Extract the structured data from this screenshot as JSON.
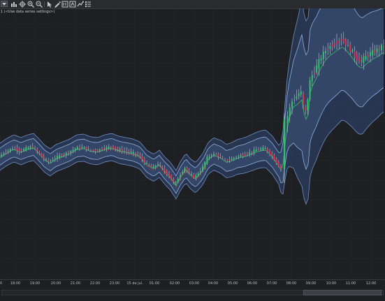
{
  "toolbar": {
    "icons": [
      "dropdown-icon",
      "bar-chart-icon",
      "crosshair-icon",
      "zoom-in-icon",
      "zoom-out-icon",
      "pointer-icon",
      "draw-tools-icon",
      "chart-trader-icon",
      "properties-icon",
      "strategy-icon",
      "list-icon"
    ]
  },
  "series_label": "1 (<Use data series settings>)",
  "axis": {
    "ticks": [
      "0",
      "18:00",
      "19:00",
      "20:00",
      "21:00",
      "22:00",
      "23:00",
      "15 de jul.",
      "01:00",
      "02:00",
      "03:00",
      "04:00",
      "05:00",
      "06:00",
      "07:00",
      "08:00",
      "09:00",
      "10:00",
      "11:00",
      "12:00"
    ]
  },
  "scrollbar": {
    "thumb_start": 0.79,
    "thumb_end": 0.995
  },
  "colors": {
    "background": "#1e1f22",
    "grid": "#2b2c30",
    "band_outer_fill": "#2a3a58",
    "band_inner_fill": "#34486a",
    "band_outer_line": "#6f8fc0",
    "band_mid_line": "#8fb0dc",
    "mid_line": "#3fa66a",
    "candle_up": "#32c26a",
    "candle_down": "#d8334f",
    "wick": "#d9dde6",
    "ma_red": "#c0392b"
  },
  "chart_data": {
    "type": "candlestick",
    "series_name": "1 (<Use data series settings>)",
    "x_ticks": [
      "0",
      "18:00",
      "19:00",
      "20:00",
      "21:00",
      "22:00",
      "23:00",
      "15 de jul.",
      "01:00",
      "02:00",
      "03:00",
      "04:00",
      "05:00",
      "06:00",
      "07:00",
      "08:00",
      "09:00",
      "10:00",
      "11:00",
      "12:00"
    ],
    "grid": true,
    "indicators": [
      "upper/lower envelope bands",
      "inner bands",
      "middle line (green)",
      "moving average (red)"
    ]
  }
}
